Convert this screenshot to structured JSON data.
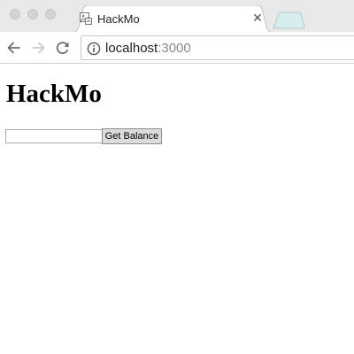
{
  "browser": {
    "tab": {
      "title": "HackMo",
      "close_glyph": "✕",
      "favicon": "broken-image-icon"
    },
    "address_bar": {
      "host": "localhost",
      "port": ":3000",
      "security_icon": "info-icon"
    },
    "nav": {
      "back_icon": "back-arrow-icon",
      "forward_icon": "forward-arrow-icon",
      "reload_icon": "reload-icon"
    }
  },
  "page": {
    "heading": "HackMo",
    "address_input": {
      "value": "",
      "placeholder": ""
    },
    "get_balance_label": "Get Balance"
  },
  "colors": {
    "tabstrip": "#e9e9e9",
    "button_face": "#dcdcdc",
    "url_port": "#8a8a8a"
  }
}
